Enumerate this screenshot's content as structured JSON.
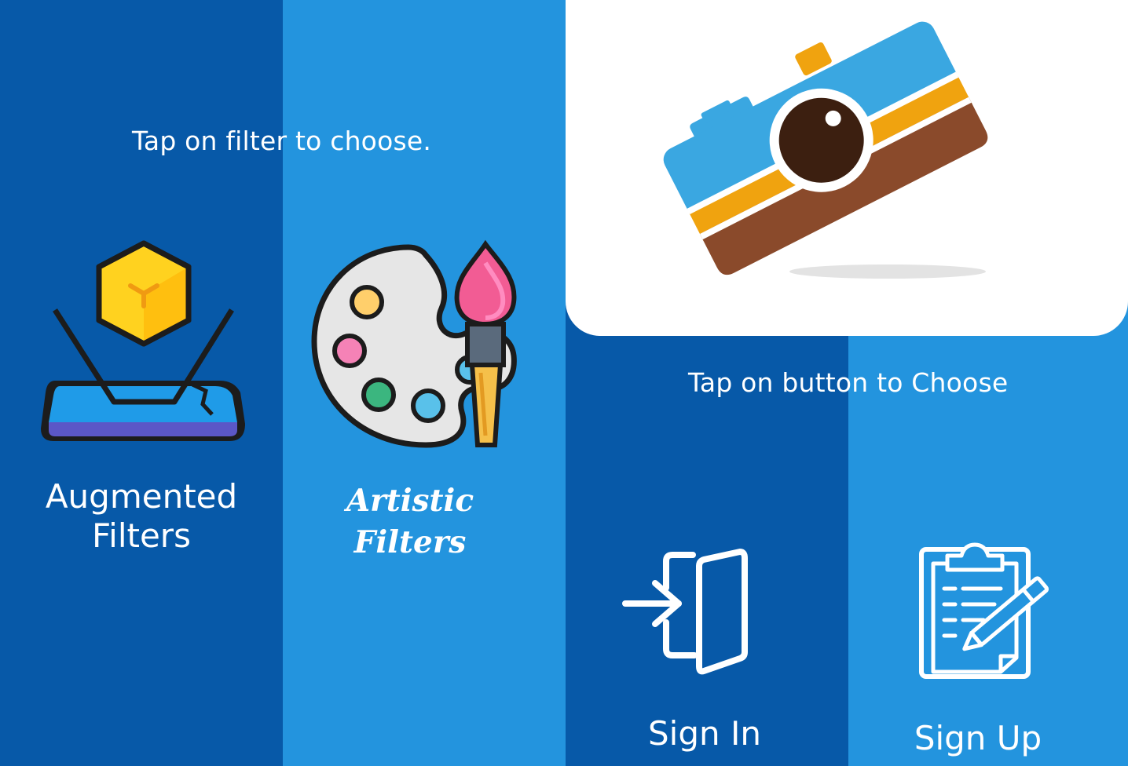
{
  "hints": {
    "filter": "Tap on filter to choose.",
    "button": "Tap on button to Choose"
  },
  "filters": {
    "augmented": {
      "line1": "Augmented",
      "line2": "Filters",
      "icon": "ar-hologram-icon"
    },
    "artistic": {
      "line1": "Artistic",
      "line2": "Filters",
      "icon": "paint-palette-icon"
    }
  },
  "auth": {
    "sign_in": "Sign In",
    "sign_up": "Sign Up"
  },
  "colors": {
    "dark_blue": "#0759a8",
    "light_blue": "#2394de",
    "white": "#ffffff"
  }
}
